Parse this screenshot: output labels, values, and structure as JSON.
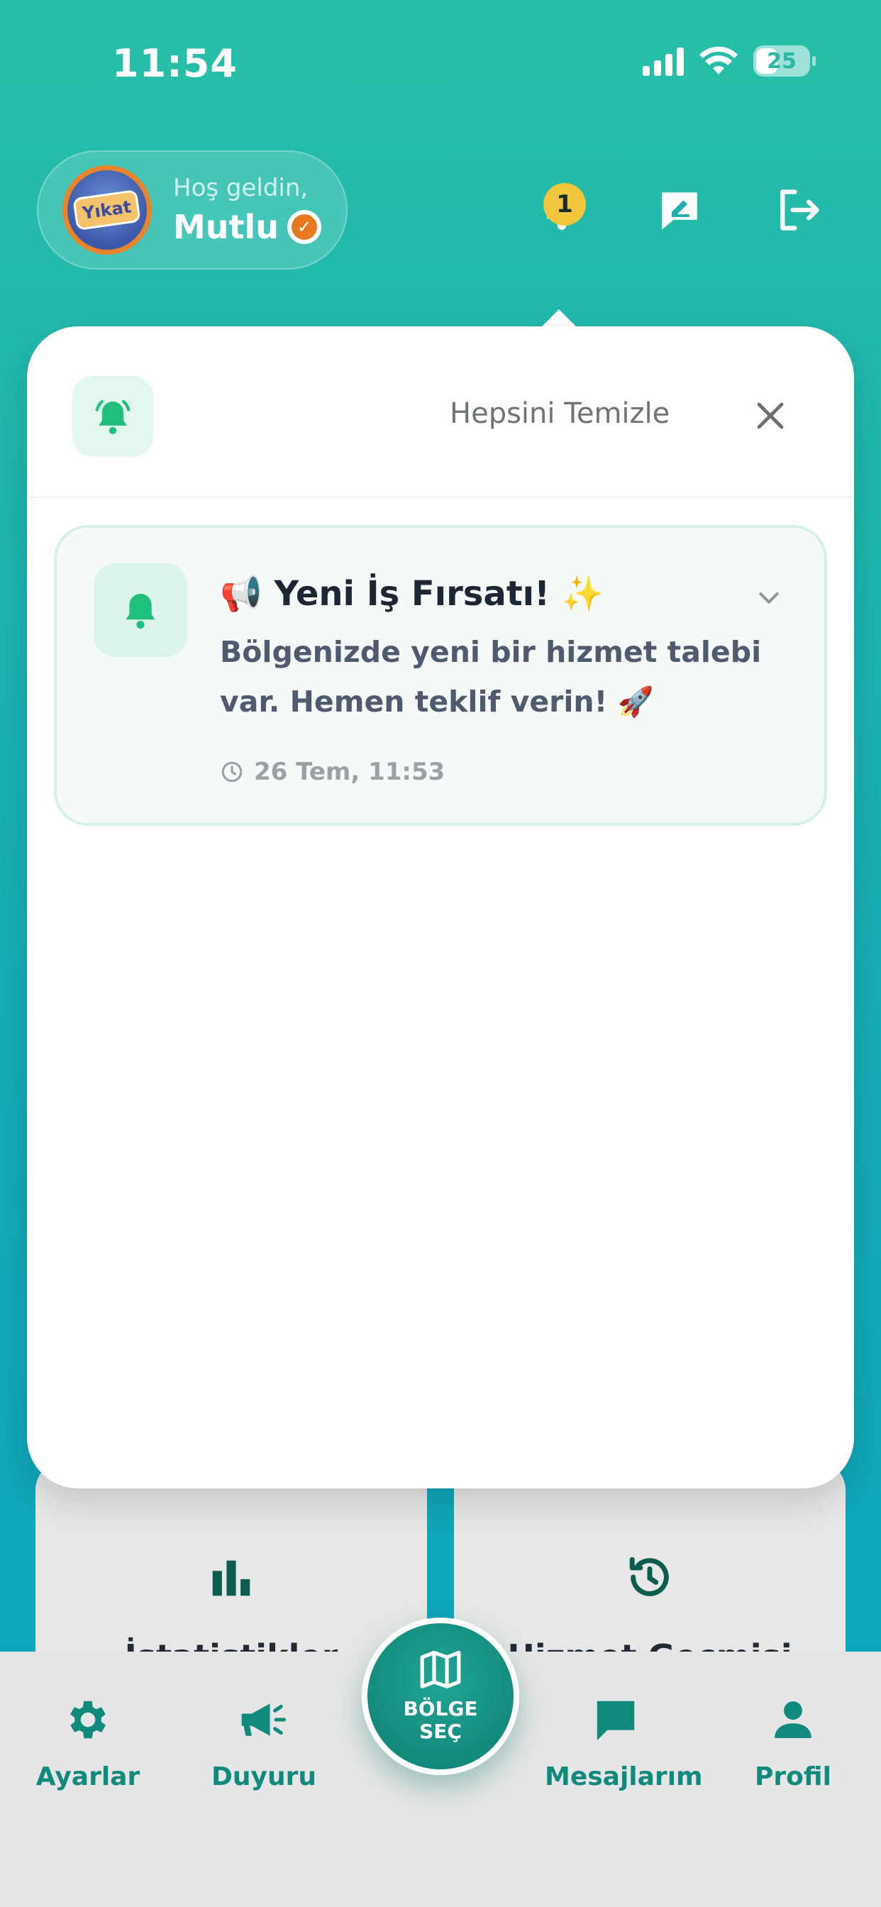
{
  "status_bar": {
    "time": "11:54",
    "battery": "25",
    "icons": [
      "signal-icon",
      "wifi-icon",
      "battery-icon"
    ]
  },
  "header": {
    "greeting": "Hoş geldin,",
    "user_name": "Mutlu",
    "avatar_logo_text": "Yıkat",
    "notification_count": "1",
    "icons": [
      "bell-icon",
      "chat-edit-icon",
      "logout-icon",
      "verified-icon"
    ]
  },
  "notifications_panel": {
    "clear_all_label": "Hepsini Temizle",
    "items": [
      {
        "title": "📢 Yeni İş Fırsatı! ✨",
        "body": "Bölgenizde yeni bir hizmet talebi var. Hemen teklif verin! 🚀",
        "time": "26 Tem, 11:53"
      }
    ]
  },
  "cards": {
    "left_label": "İstatistikler",
    "right_label": "Hizmet Geçmişi"
  },
  "bottom_nav": {
    "items": [
      {
        "label": "Ayarlar",
        "icon": "gear-icon"
      },
      {
        "label": "Duyuru",
        "icon": "megaphone-icon"
      },
      {
        "label": "Mesajlarım",
        "icon": "message-icon"
      },
      {
        "label": "Profil",
        "icon": "person-icon"
      }
    ],
    "center_label": "BÖLGE SEÇ",
    "center_icon": "map-icon"
  },
  "colors": {
    "primary": "#0f8a7d",
    "accent_green": "#1fbf7e",
    "badge": "#f1c63c",
    "background_top": "#27bea8",
    "background_bottom": "#0aa2bd"
  }
}
